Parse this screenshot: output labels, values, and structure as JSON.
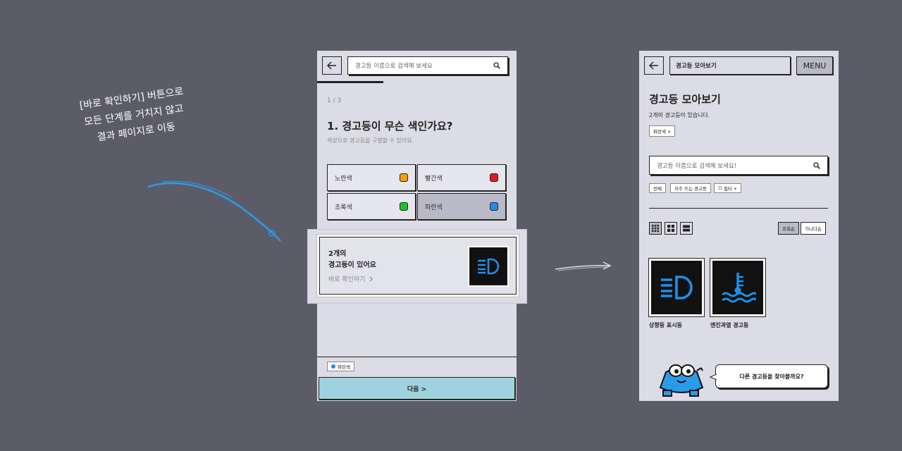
{
  "caption": {
    "line1": "[바로 확인하기] 버튼으로",
    "line2": "모든 단계를 거치지 않고",
    "line3": "결과 페이지로 이동"
  },
  "left_screen": {
    "search_placeholder": "경고등 이름으로 검색해 보세요",
    "progress": {
      "step_text": "1 / 3",
      "fraction": 0.333
    },
    "question_title": "1. 경고등이 무슨 색인가요?",
    "question_subtitle": "색상으로 경고등을 구별할 수 있어요.",
    "options": [
      {
        "label": "노란색",
        "color": "#f2a007",
        "selected": false
      },
      {
        "label": "빨간색",
        "color": "#e01b1b",
        "selected": false
      },
      {
        "label": "초록색",
        "color": "#22c02a",
        "selected": false
      },
      {
        "label": "파란색",
        "color": "#1e90e8",
        "selected": true
      }
    ],
    "result_popup": {
      "line1": "2개의",
      "line2": "경고등이 있어요",
      "link": "바로 확인하기",
      "link_icon": "chevron-right-icon"
    },
    "selected_tag": "파란색",
    "next_button": "다음 >"
  },
  "right_screen": {
    "header_title": "경고등 모아보기",
    "menu_button": "MENU",
    "page_title": "경고등 모아보기",
    "count_text": "2개의 경고등이 있습니다.",
    "filter_chip": "파란색 ×",
    "search_placeholder": "경고등 이름으로 검색해 보세요!",
    "filter_buttons": [
      "전체",
      "자주 뜨는 경고등",
      "필터 +"
    ],
    "sort_buttons": [
      "조회순",
      "가나다순"
    ],
    "cards": [
      {
        "name": "상향등 표시등",
        "icon": "high-beam-icon"
      },
      {
        "name": "엔진과열 경고등",
        "icon": "engine-temperature-icon"
      }
    ],
    "speech_bubble": "다른 경고등을 찾아볼까요?"
  },
  "colors": {
    "background": "#5c5c68",
    "screen": "#dcdce6",
    "accent_blue": "#1e90e8",
    "next_button": "#9fd2de"
  }
}
